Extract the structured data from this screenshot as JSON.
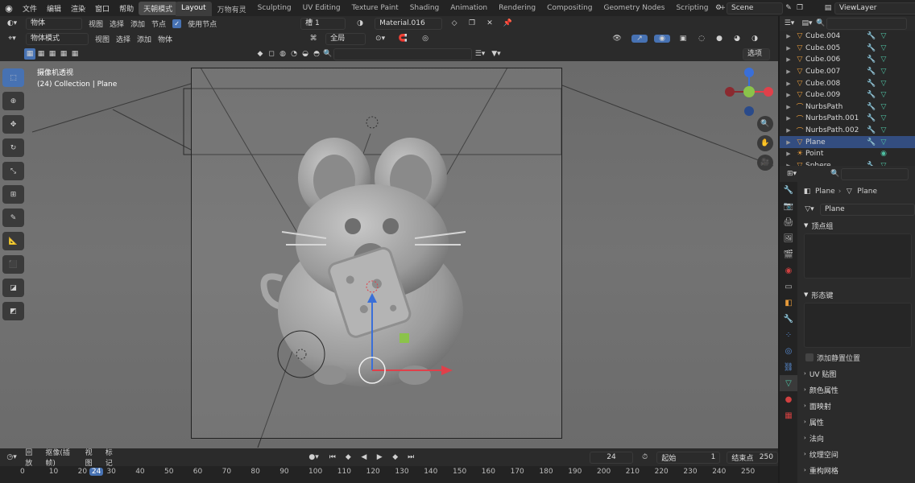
{
  "menu": {
    "items": [
      "文件",
      "编辑",
      "渲染",
      "窗口",
      "帮助"
    ],
    "badge": "天朝模式"
  },
  "workspaces": [
    "Layout",
    "万物有灵",
    "Sculpting",
    "UV Editing",
    "Texture Paint",
    "Shading",
    "Animation",
    "Rendering",
    "Compositing",
    "Geometry Nodes",
    "Scripting"
  ],
  "active_workspace": "Layout",
  "scene": "Scene",
  "view_layer": "ViewLayer",
  "nodebar": {
    "mode": "物体",
    "menus": [
      "视图",
      "选择",
      "添加",
      "节点"
    ],
    "use_nodes": "使用节点",
    "slot": "槽 1",
    "material": "Material.016"
  },
  "viewport_header": {
    "mode": "物体模式",
    "menus": [
      "视图",
      "选择",
      "添加",
      "物体"
    ],
    "orientation": "全局",
    "options": "选项"
  },
  "viewport": {
    "view_name": "摄像机透视",
    "collection": "(24) Collection | Plane"
  },
  "outliner": {
    "items": [
      {
        "name": "Cube.004",
        "icon": "mesh-icon"
      },
      {
        "name": "Cube.005",
        "icon": "mesh-icon"
      },
      {
        "name": "Cube.006",
        "icon": "mesh-icon"
      },
      {
        "name": "Cube.007",
        "icon": "mesh-icon"
      },
      {
        "name": "Cube.008",
        "icon": "mesh-icon"
      },
      {
        "name": "Cube.009",
        "icon": "mesh-icon"
      },
      {
        "name": "NurbsPath",
        "icon": "curve-icon"
      },
      {
        "name": "NurbsPath.001",
        "icon": "curve-icon"
      },
      {
        "name": "NurbsPath.002",
        "icon": "curve-icon"
      },
      {
        "name": "Plane",
        "icon": "mesh-icon",
        "selected": true
      },
      {
        "name": "Point",
        "icon": "light-icon"
      },
      {
        "name": "Sphere",
        "icon": "mesh-icon"
      }
    ]
  },
  "properties": {
    "object": "Plane",
    "mesh": "Plane",
    "data_name": "Plane",
    "panels": {
      "vertex_groups": "顶点组",
      "shape_keys": "形态键",
      "add_rest_position": "添加静置位置",
      "uv_maps": "UV 贴图",
      "color_attributes": "颜色属性",
      "face_maps": "面映射",
      "attributes": "属性",
      "normals": "法向",
      "texture_space": "纹理空间",
      "remesh": "重构网格"
    }
  },
  "timeline": {
    "menus": [
      "回放",
      "抠像(插帧)",
      "视图",
      "标记"
    ],
    "current_frame": "24",
    "start_label": "起始",
    "start": "1",
    "end_label": "结束点",
    "end": "250",
    "ruler": [
      "0",
      "10",
      "20",
      "24",
      "30",
      "40",
      "50",
      "60",
      "70",
      "80",
      "90",
      "100",
      "110",
      "120",
      "130",
      "140",
      "150",
      "160",
      "170",
      "180",
      "190",
      "200",
      "210",
      "220",
      "230",
      "240",
      "250"
    ]
  },
  "colors": {
    "accent": "#4772b3",
    "selected_row": "#334d80",
    "mesh_icon": "#4fc1a3",
    "object_icon": "#e69a3a",
    "axis_x": "#e0404a",
    "axis_y": "#8bc34a",
    "axis_z": "#3a6fd8"
  }
}
